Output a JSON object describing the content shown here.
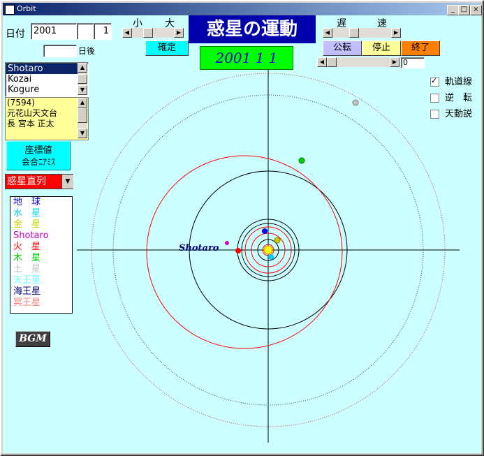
{
  "window": {
    "title": "Orbit",
    "min": "_",
    "max": "□",
    "close": "×"
  },
  "date": {
    "label": "日付",
    "year": "2001",
    "month": "",
    "day": "1",
    "days_after_value": "",
    "days_after_label": "日後"
  },
  "scale": {
    "small": "小",
    "large": "大",
    "confirm": "確定"
  },
  "speed": {
    "slow": "遅",
    "fast": "速",
    "value": "0"
  },
  "title": {
    "main": "惑星の運動",
    "date_display": "2001 1 1"
  },
  "controls": {
    "revolve": "公転",
    "stop": "停止",
    "quit": "終了"
  },
  "checkboxes": [
    {
      "label": "軌道線",
      "checked": true,
      "mark": "✓"
    },
    {
      "label": "逆　転",
      "checked": false,
      "mark": ""
    },
    {
      "label": "天動説",
      "checked": false,
      "mark": ""
    }
  ],
  "asteroid_list": {
    "items": [
      "Shotaro",
      "Kozai",
      "Kogure"
    ],
    "selected": 0
  },
  "info_box": {
    "lines": [
      "(7594)",
      "元花山天文台",
      "長 宮本 正太"
    ]
  },
  "coord_button": {
    "line1": "座標値",
    "line2": "会合ﾆｱﾐｽ"
  },
  "alignment_select": {
    "value": "惑星直列"
  },
  "legend": [
    {
      "label": "地　球",
      "color": "#0000ff"
    },
    {
      "label": "水　星",
      "color": "#00ccff"
    },
    {
      "label": "金　星",
      "color": "#cccc00"
    },
    {
      "label": "Shotaro",
      "color": "#cc00cc"
    },
    {
      "label": "火　星",
      "color": "#ff0000"
    },
    {
      "label": "木　星",
      "color": "#00cc00"
    },
    {
      "label": "土　星",
      "color": "#c0c0c0"
    },
    {
      "label": "天王星",
      "color": "#66ffff"
    },
    {
      "label": "海王星",
      "color": "#000080"
    },
    {
      "label": "冥王星",
      "color": "#ff8080"
    }
  ],
  "bgm": {
    "label": "BGM"
  },
  "orbit": {
    "asteroid_label": "Shotaro"
  }
}
